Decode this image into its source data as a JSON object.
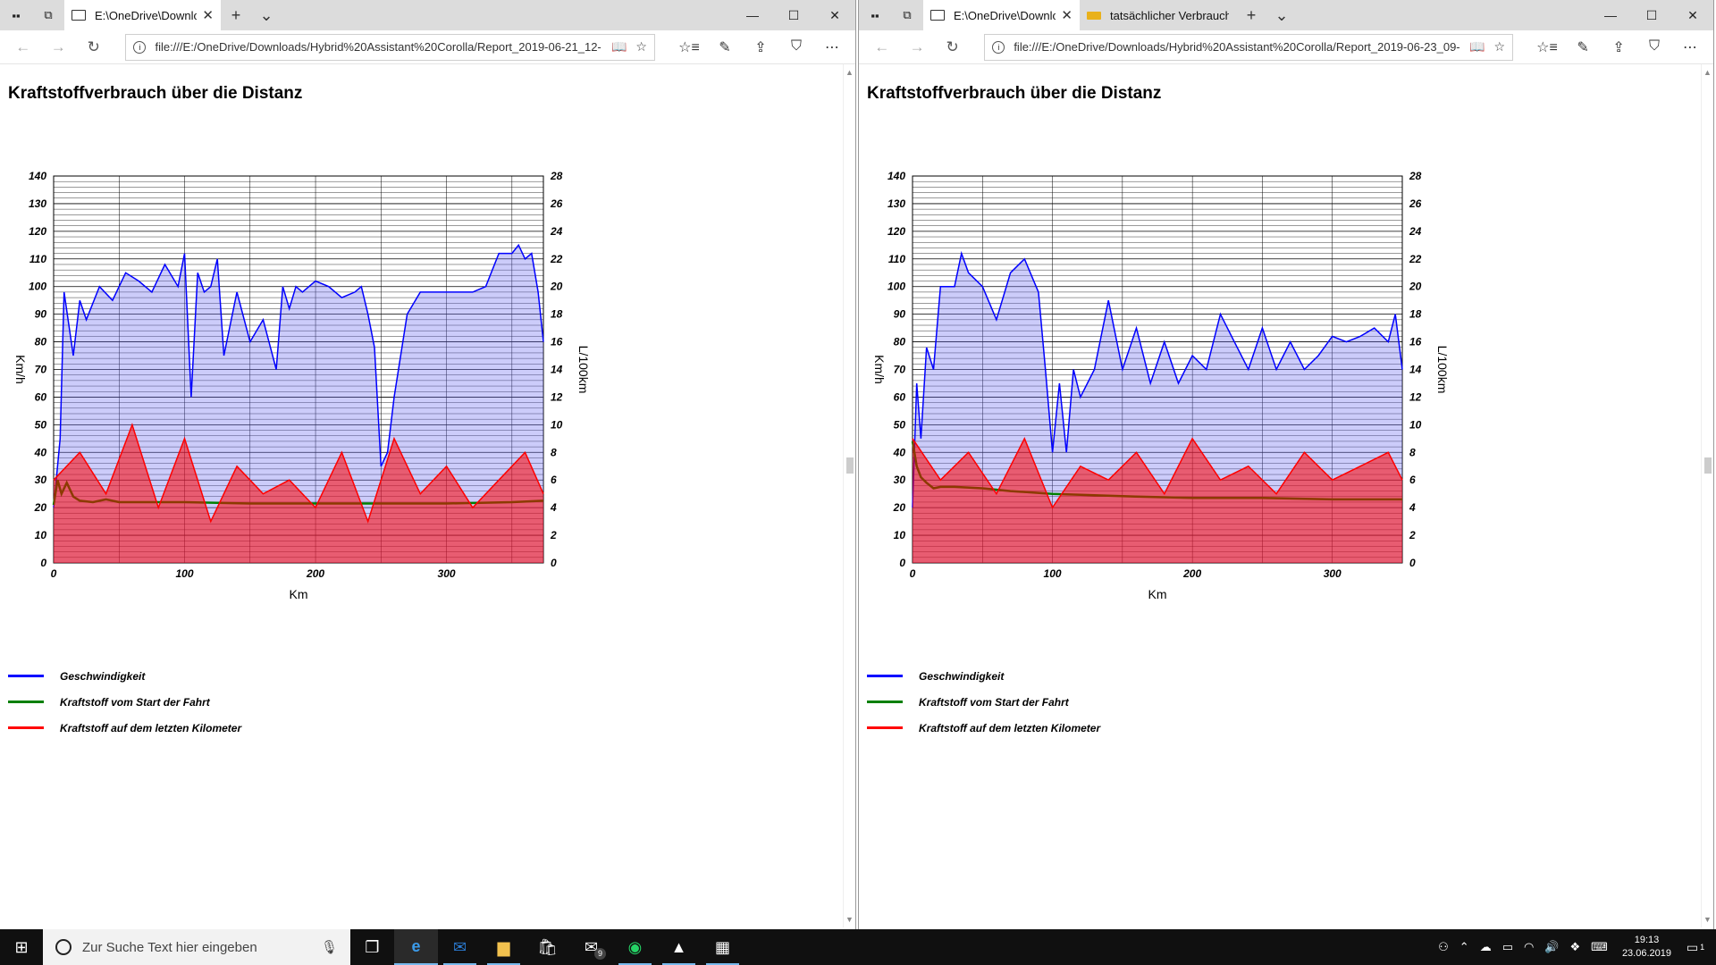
{
  "windows": [
    {
      "id": "left",
      "tabs": [
        {
          "title": "E:\\OneDrive\\Downloads",
          "active": true
        }
      ],
      "address": "file:///E:/OneDrive/Downloads/Hybrid%20Assistant%20Corolla/Report_2019-06-21_12-",
      "page_title": "Kraftstoffverbrauch über die Distanz",
      "legend": [
        "Geschwindigkeit",
        "Kraftstoff vom Start der Fahrt",
        "Kraftstoff auf dem letzten Kilometer"
      ],
      "chart_data": {
        "type": "line",
        "title": "Kraftstoffverbrauch über die Distanz",
        "xlabel": "Km",
        "ylabel": "Km/h",
        "y2label": "L/100km",
        "xlim": [
          0,
          374
        ],
        "ylim": [
          0,
          140
        ],
        "y2lim": [
          0,
          28
        ],
        "x_ticks": [
          0,
          100,
          200,
          300
        ],
        "y_ticks": [
          0,
          10,
          20,
          30,
          40,
          50,
          60,
          70,
          80,
          90,
          100,
          110,
          120,
          130,
          140
        ],
        "y2_ticks": [
          0,
          2,
          4,
          6,
          8,
          10,
          12,
          14,
          16,
          18,
          20,
          22,
          24,
          26,
          28
        ],
        "grid": true,
        "legend_position": "bottom-left",
        "series": [
          {
            "name": "Geschwindigkeit",
            "axis": "left",
            "color": "#0000ff",
            "x": [
              0,
              5,
              8,
              15,
              20,
              25,
              35,
              45,
              55,
              65,
              75,
              85,
              95,
              100,
              105,
              110,
              115,
              120,
              125,
              130,
              140,
              150,
              160,
              170,
              175,
              180,
              185,
              190,
              195,
              200,
              210,
              220,
              230,
              235,
              240,
              245,
              250,
              255,
              260,
              270,
              280,
              290,
              300,
              310,
              320,
              330,
              340,
              350,
              355,
              360,
              365,
              370,
              374
            ],
            "y": [
              20,
              45,
              98,
              75,
              95,
              88,
              100,
              95,
              105,
              102,
              98,
              108,
              100,
              112,
              60,
              105,
              98,
              100,
              110,
              75,
              98,
              80,
              88,
              70,
              100,
              92,
              100,
              98,
              100,
              102,
              100,
              96,
              98,
              100,
              90,
              78,
              35,
              40,
              60,
              90,
              98,
              98,
              98,
              98,
              98,
              100,
              112,
              112,
              115,
              110,
              112,
              98,
              80
            ]
          },
          {
            "name": "Kraftstoff vom Start der Fahrt",
            "axis": "right",
            "color": "#008000",
            "x": [
              0,
              3,
              6,
              10,
              15,
              20,
              30,
              40,
              50,
              60,
              80,
              100,
              150,
              200,
              250,
              300,
              350,
              374
            ],
            "y": [
              4.2,
              6.0,
              5.0,
              5.8,
              4.8,
              4.5,
              4.4,
              4.6,
              4.4,
              4.4,
              4.4,
              4.4,
              4.3,
              4.3,
              4.3,
              4.3,
              4.4,
              4.5
            ]
          },
          {
            "name": "Kraftstoff auf dem letzten Kilometer",
            "axis": "right",
            "color": "#ff0000",
            "x": [
              0,
              20,
              40,
              60,
              80,
              100,
              120,
              140,
              160,
              180,
              200,
              220,
              240,
              260,
              280,
              300,
              320,
              340,
              360,
              374
            ],
            "y": [
              6,
              8,
              5,
              10,
              4,
              9,
              3,
              7,
              5,
              6,
              4,
              8,
              3,
              9,
              5,
              7,
              4,
              6,
              8,
              5
            ]
          }
        ]
      }
    },
    {
      "id": "right",
      "tabs": [
        {
          "title": "E:\\OneDrive\\Downloads",
          "active": true
        },
        {
          "title": "tatsächlicher Verbrauch - PF",
          "active": false
        }
      ],
      "address": "file:///E:/OneDrive/Downloads/Hybrid%20Assistant%20Corolla/Report_2019-06-23_09-",
      "page_title": "Kraftstoffverbrauch über die Distanz",
      "legend": [
        "Geschwindigkeit",
        "Kraftstoff vom Start der Fahrt",
        "Kraftstoff auf dem letzten Kilometer"
      ],
      "chart_data": {
        "type": "line",
        "title": "Kraftstoffverbrauch über die Distanz",
        "xlabel": "Km",
        "ylabel": "Km/h",
        "y2label": "L/100km",
        "xlim": [
          0,
          350
        ],
        "ylim": [
          0,
          140
        ],
        "y2lim": [
          0,
          28
        ],
        "x_ticks": [
          0,
          100,
          200,
          300
        ],
        "y_ticks": [
          0,
          10,
          20,
          30,
          40,
          50,
          60,
          70,
          80,
          90,
          100,
          110,
          120,
          130,
          140
        ],
        "y2_ticks": [
          0,
          2,
          4,
          6,
          8,
          10,
          12,
          14,
          16,
          18,
          20,
          22,
          24,
          26,
          28
        ],
        "grid": true,
        "legend_position": "bottom-left",
        "series": [
          {
            "name": "Geschwindigkeit",
            "axis": "left",
            "color": "#0000ff",
            "x": [
              0,
              3,
              6,
              10,
              15,
              20,
              30,
              35,
              40,
              50,
              60,
              70,
              80,
              90,
              95,
              100,
              105,
              110,
              115,
              120,
              130,
              140,
              150,
              160,
              170,
              180,
              190,
              200,
              210,
              220,
              230,
              240,
              250,
              260,
              270,
              280,
              290,
              300,
              310,
              320,
              330,
              340,
              345,
              350
            ],
            "y": [
              20,
              65,
              45,
              78,
              70,
              100,
              100,
              112,
              105,
              100,
              88,
              105,
              110,
              98,
              70,
              40,
              65,
              40,
              70,
              60,
              70,
              95,
              70,
              85,
              65,
              80,
              65,
              75,
              70,
              90,
              80,
              70,
              85,
              70,
              80,
              70,
              75,
              82,
              80,
              82,
              85,
              80,
              90,
              70
            ]
          },
          {
            "name": "Kraftstoff vom Start der Fahrt",
            "axis": "right",
            "color": "#008000",
            "x": [
              0,
              3,
              6,
              10,
              15,
              20,
              30,
              50,
              70,
              100,
              130,
              160,
              200,
              250,
              300,
              350
            ],
            "y": [
              8.8,
              7.0,
              6.2,
              5.8,
              5.4,
              5.5,
              5.5,
              5.4,
              5.2,
              5.0,
              4.9,
              4.8,
              4.7,
              4.7,
              4.6,
              4.6
            ]
          },
          {
            "name": "Kraftstoff auf dem letzten Kilometer",
            "axis": "right",
            "color": "#ff0000",
            "x": [
              0,
              20,
              40,
              60,
              80,
              100,
              120,
              140,
              160,
              180,
              200,
              220,
              240,
              260,
              280,
              300,
              320,
              340,
              350
            ],
            "y": [
              9,
              6,
              8,
              5,
              9,
              4,
              7,
              6,
              8,
              5,
              9,
              6,
              7,
              5,
              8,
              6,
              7,
              8,
              6
            ]
          }
        ]
      }
    }
  ],
  "taskbar": {
    "search_placeholder": "Zur Suche Text hier eingeben",
    "mail_badge": "9",
    "time": "19:13",
    "date": "23.06.2019",
    "notification_count": "1"
  }
}
